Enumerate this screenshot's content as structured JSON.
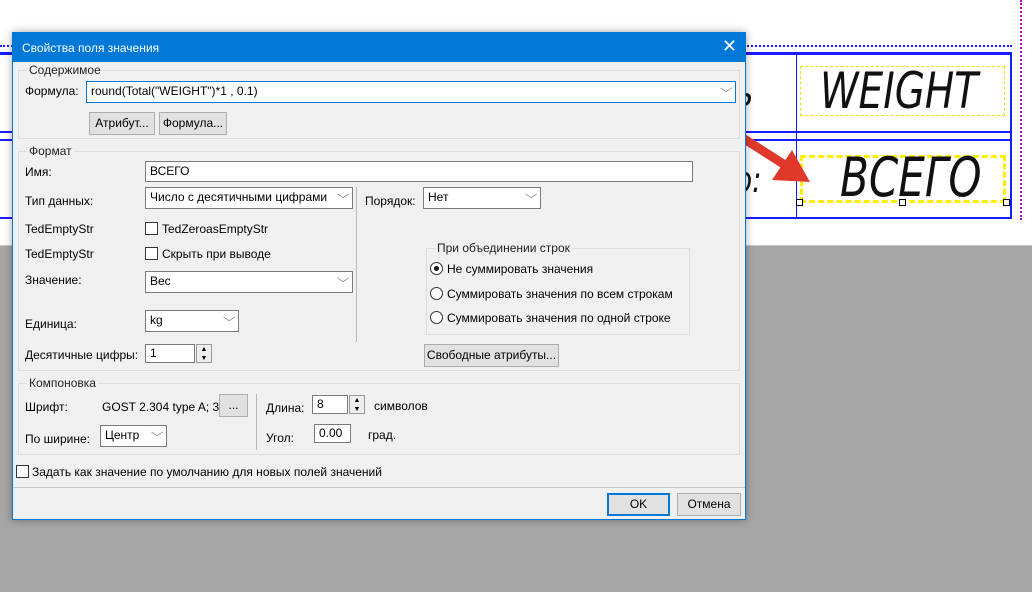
{
  "drawing": {
    "cell_top": "WEIGHT",
    "cell_bottom": "ВСЕГО",
    "left_partial_top": "ь",
    "left_partial_bottom": "о:"
  },
  "dialog": {
    "title": "Свойства поля значения",
    "content_group": "Содержимое",
    "formula_label": "Формула:",
    "formula_value": "round(Total(\"WEIGHT\")*1 , 0.1)",
    "attribute_button": "Атрибут...",
    "formula_button": "Формула...",
    "format_group": "Формат",
    "name_label": "Имя:",
    "name_value": "ВСЕГО",
    "datatype_label": "Тип данных:",
    "datatype_value": "Число с десятичными цифрами",
    "order_label": "Порядок:",
    "order_value": "Нет",
    "empty_str_label_1": "TedEmptyStr",
    "zeroes_empty_checkbox": "TedZeroasEmptyStr",
    "empty_str_label_2": "TedEmptyStr",
    "hide_checkbox": "Скрыть при выводе",
    "value_label": "Значение:",
    "value_value": "Вес",
    "unit_label": "Единица:",
    "unit_value": "kg",
    "decimals_label": "Десятичные цифры:",
    "decimals_value": "1",
    "merge_group": "При объединении строк",
    "merge_options": [
      "Не суммировать значения",
      "Суммировать значения по всем строкам",
      "Суммировать значения по одной строке"
    ],
    "merge_selected": 0,
    "free_attributes_button": "Свободные атрибуты...",
    "layout_group": "Компоновка",
    "font_label": "Шрифт:",
    "font_value": "GOST 2.304 type A; 3",
    "font_button": "...",
    "width_label": "По ширине:",
    "width_value": "Центр",
    "length_label": "Длина:",
    "length_value": "8",
    "length_unit": "символов",
    "angle_label": "Угол:",
    "angle_value": "0.00",
    "angle_unit": "град.",
    "default_checkbox": "Задать как значение по умолчанию для новых полей значений",
    "ok_button": "OK",
    "cancel_button": "Отмена"
  },
  "colors": {
    "titlebar": "#0078d7",
    "arrow": "#e0392b",
    "highlight": "#ffee00"
  }
}
